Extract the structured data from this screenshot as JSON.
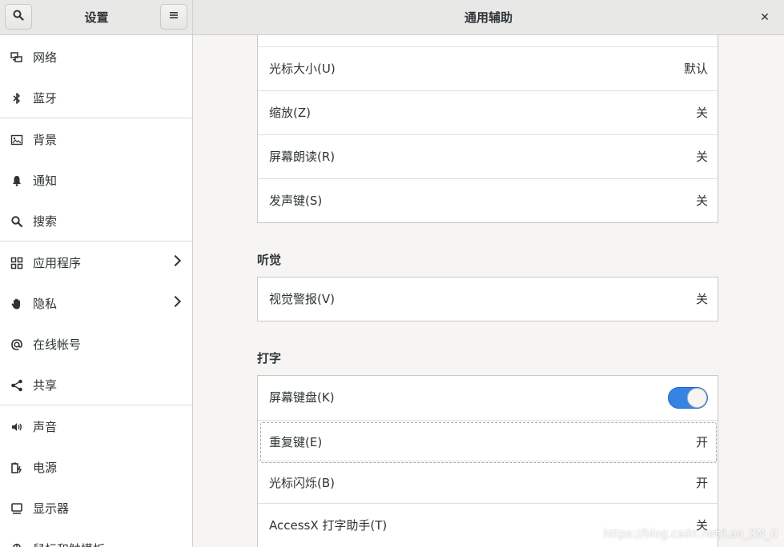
{
  "header": {
    "sidebar_title": "设置",
    "main_title": "通用辅助",
    "close_symbol": "✕"
  },
  "sidebar": {
    "items": [
      {
        "label": "网络",
        "icon": "network-icon"
      },
      {
        "label": "蓝牙",
        "icon": "bluetooth-icon"
      },
      {
        "label": "背景",
        "icon": "background-icon"
      },
      {
        "label": "通知",
        "icon": "bell-icon"
      },
      {
        "label": "搜索",
        "icon": "search-icon"
      },
      {
        "label": "应用程序",
        "icon": "apps-icon",
        "has_submenu": true
      },
      {
        "label": "隐私",
        "icon": "hand-icon",
        "has_submenu": true
      },
      {
        "label": "在线帐号",
        "icon": "at-icon"
      },
      {
        "label": "共享",
        "icon": "share-icon"
      },
      {
        "label": "声音",
        "icon": "speaker-icon"
      },
      {
        "label": "电源",
        "icon": "power-icon"
      },
      {
        "label": "显示器",
        "icon": "display-icon"
      },
      {
        "label": "鼠标和触摸板",
        "icon": "mouse-icon"
      }
    ]
  },
  "seeing": {
    "rows": [
      {
        "label": "光标大小(U)",
        "value": "默认"
      },
      {
        "label": "缩放(Z)",
        "value": "关"
      },
      {
        "label": "屏幕朗读(R)",
        "value": "关"
      },
      {
        "label": "发声键(S)",
        "value": "关"
      }
    ]
  },
  "hearing": {
    "title": "听觉",
    "rows": [
      {
        "label": "视觉警报(V)",
        "value": "关"
      }
    ]
  },
  "typing": {
    "title": "打字",
    "screen_keyboard": {
      "label": "屏幕键盘(K)",
      "enabled": true
    },
    "rows": [
      {
        "label": "重复键(E)",
        "value": "开"
      },
      {
        "label": "光标闪烁(B)",
        "value": "开"
      },
      {
        "label": "AccessX 打字助手(T)",
        "value": "关"
      }
    ]
  },
  "colors": {
    "accent": "#3584e4"
  },
  "watermark": "https://blog.csdn.net/Leo_ZN_0"
}
